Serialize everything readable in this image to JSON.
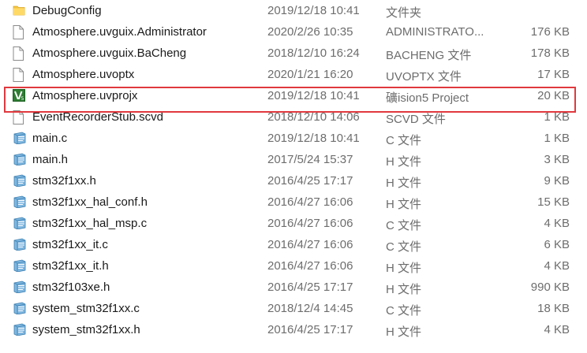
{
  "files": [
    {
      "name": "DebugConfig",
      "date": "2019/12/18 10:41",
      "type": "文件夹",
      "size": "",
      "icon": "folder-icon"
    },
    {
      "name": "Atmosphere.uvguix.Administrator",
      "date": "2020/2/26 10:35",
      "type": "ADMINISTRATO...",
      "size": "176 KB",
      "icon": "file-icon"
    },
    {
      "name": "Atmosphere.uvguix.BaCheng",
      "date": "2018/12/10 16:24",
      "type": "BACHENG 文件",
      "size": "178 KB",
      "icon": "file-icon"
    },
    {
      "name": "Atmosphere.uvoptx",
      "date": "2020/1/21 16:20",
      "type": "UVOPTX 文件",
      "size": "17 KB",
      "icon": "file-icon"
    },
    {
      "name": "Atmosphere.uvprojx",
      "date": "2019/12/18 10:41",
      "type": "礦ision5 Project",
      "size": "20 KB",
      "icon": "keil-project-icon",
      "selected": true
    },
    {
      "name": "EventRecorderStub.scvd",
      "date": "2018/12/10 14:06",
      "type": "SCVD 文件",
      "size": "1 KB",
      "icon": "file-icon"
    },
    {
      "name": "main.c",
      "date": "2019/12/18 10:41",
      "type": "C 文件",
      "size": "1 KB",
      "icon": "source-file-icon"
    },
    {
      "name": "main.h",
      "date": "2017/5/24 15:37",
      "type": "H 文件",
      "size": "3 KB",
      "icon": "source-file-icon"
    },
    {
      "name": "stm32f1xx.h",
      "date": "2016/4/25 17:17",
      "type": "H 文件",
      "size": "9 KB",
      "icon": "source-file-icon"
    },
    {
      "name": "stm32f1xx_hal_conf.h",
      "date": "2016/4/27 16:06",
      "type": "H 文件",
      "size": "15 KB",
      "icon": "source-file-icon"
    },
    {
      "name": "stm32f1xx_hal_msp.c",
      "date": "2016/4/27 16:06",
      "type": "C 文件",
      "size": "4 KB",
      "icon": "source-file-icon"
    },
    {
      "name": "stm32f1xx_it.c",
      "date": "2016/4/27 16:06",
      "type": "C 文件",
      "size": "6 KB",
      "icon": "source-file-icon"
    },
    {
      "name": "stm32f1xx_it.h",
      "date": "2016/4/27 16:06",
      "type": "H 文件",
      "size": "4 KB",
      "icon": "source-file-icon"
    },
    {
      "name": "stm32f103xe.h",
      "date": "2016/4/25 17:17",
      "type": "H 文件",
      "size": "990 KB",
      "icon": "source-file-icon"
    },
    {
      "name": "system_stm32f1xx.c",
      "date": "2018/12/4 14:45",
      "type": "C 文件",
      "size": "18 KB",
      "icon": "source-file-icon"
    },
    {
      "name": "system_stm32f1xx.h",
      "date": "2016/4/25 17:17",
      "type": "H 文件",
      "size": "4 KB",
      "icon": "source-file-icon"
    }
  ],
  "colors": {
    "selection_border": "#e0393e",
    "folder": "#f5c542",
    "keil": "#2e7d32"
  }
}
